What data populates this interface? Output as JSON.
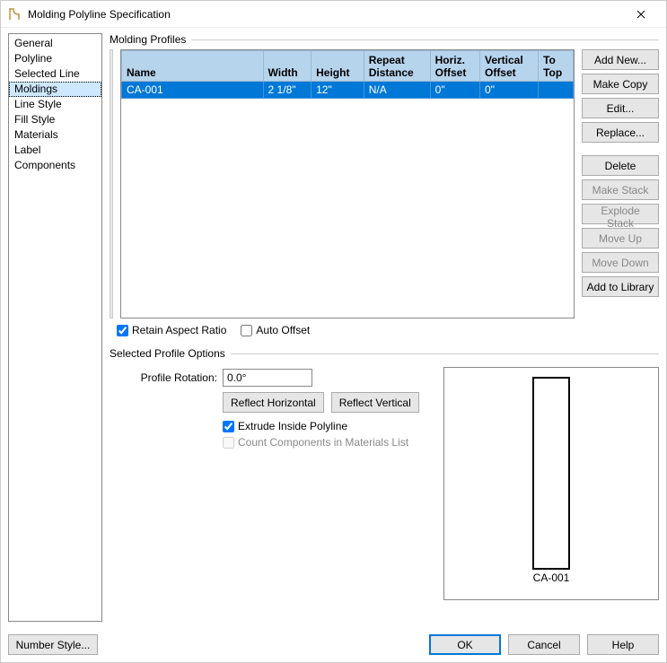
{
  "window": {
    "title": "Molding Polyline Specification"
  },
  "sidebar": {
    "items": [
      {
        "label": "General"
      },
      {
        "label": "Polyline"
      },
      {
        "label": "Selected Line"
      },
      {
        "label": "Moldings"
      },
      {
        "label": "Line Style"
      },
      {
        "label": "Fill Style"
      },
      {
        "label": "Materials"
      },
      {
        "label": "Label"
      },
      {
        "label": "Components"
      }
    ],
    "selected_index": 3
  },
  "groups": {
    "profiles": "Molding Profiles",
    "selected": "Selected Profile Options"
  },
  "table": {
    "headers": {
      "name": "Name",
      "width": "Width",
      "height": "Height",
      "repeat": "Repeat Distance",
      "hoffset": "Horiz. Offset",
      "voffset": "Vertical Offset",
      "totop": "To Top"
    },
    "rows": [
      {
        "name": "CA-001",
        "width": "2 1/8\"",
        "height": "12\"",
        "repeat": "N/A",
        "hoffset": "0\"",
        "voffset": "0\"",
        "totop": ""
      }
    ]
  },
  "buttons": {
    "add_new": "Add New...",
    "make_copy": "Make Copy",
    "edit": "Edit...",
    "replace": "Replace...",
    "delete": "Delete",
    "make_stack": "Make Stack",
    "explode_stack": "Explode Stack",
    "move_up": "Move Up",
    "move_down": "Move Down",
    "add_library": "Add to Library"
  },
  "checks": {
    "retain_aspect": "Retain Aspect Ratio",
    "auto_offset": "Auto Offset",
    "extrude": "Extrude Inside Polyline",
    "count_components": "Count Components in Materials List"
  },
  "form": {
    "rotation_label": "Profile Rotation:",
    "rotation_value": "0.0°",
    "reflect_h": "Reflect Horizontal",
    "reflect_v": "Reflect Vertical"
  },
  "preview": {
    "label": "CA-001"
  },
  "footer": {
    "number_style": "Number Style...",
    "ok": "OK",
    "cancel": "Cancel",
    "help": "Help"
  }
}
